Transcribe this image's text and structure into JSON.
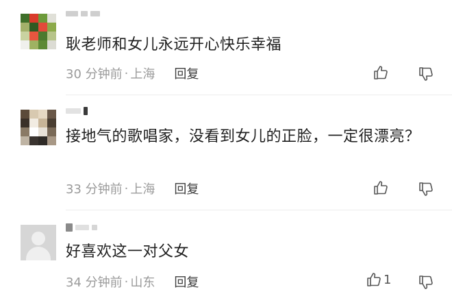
{
  "comments": [
    {
      "text": "耿老师和女儿永远开心快乐幸福",
      "time": "30 分钟前",
      "location": "上海",
      "reply_label": "回复",
      "like_count": ""
    },
    {
      "text": "接地气的歌唱家，没看到女儿的正脸，一定很漂亮？",
      "time": "33 分钟前",
      "location": "上海",
      "reply_label": "回复",
      "like_count": ""
    },
    {
      "text": "好喜欢这一对父女",
      "time": "34 分钟前",
      "location": "山东",
      "reply_label": "回复",
      "like_count": "1"
    }
  ],
  "meta_separator": "·",
  "icons": {
    "like": "thumbs-up-icon",
    "dislike": "thumbs-down-icon"
  },
  "colors": {
    "text": "#1f1f1f",
    "meta": "#9a9a9a",
    "reply": "#3c3c3c",
    "icon": "#555555"
  }
}
